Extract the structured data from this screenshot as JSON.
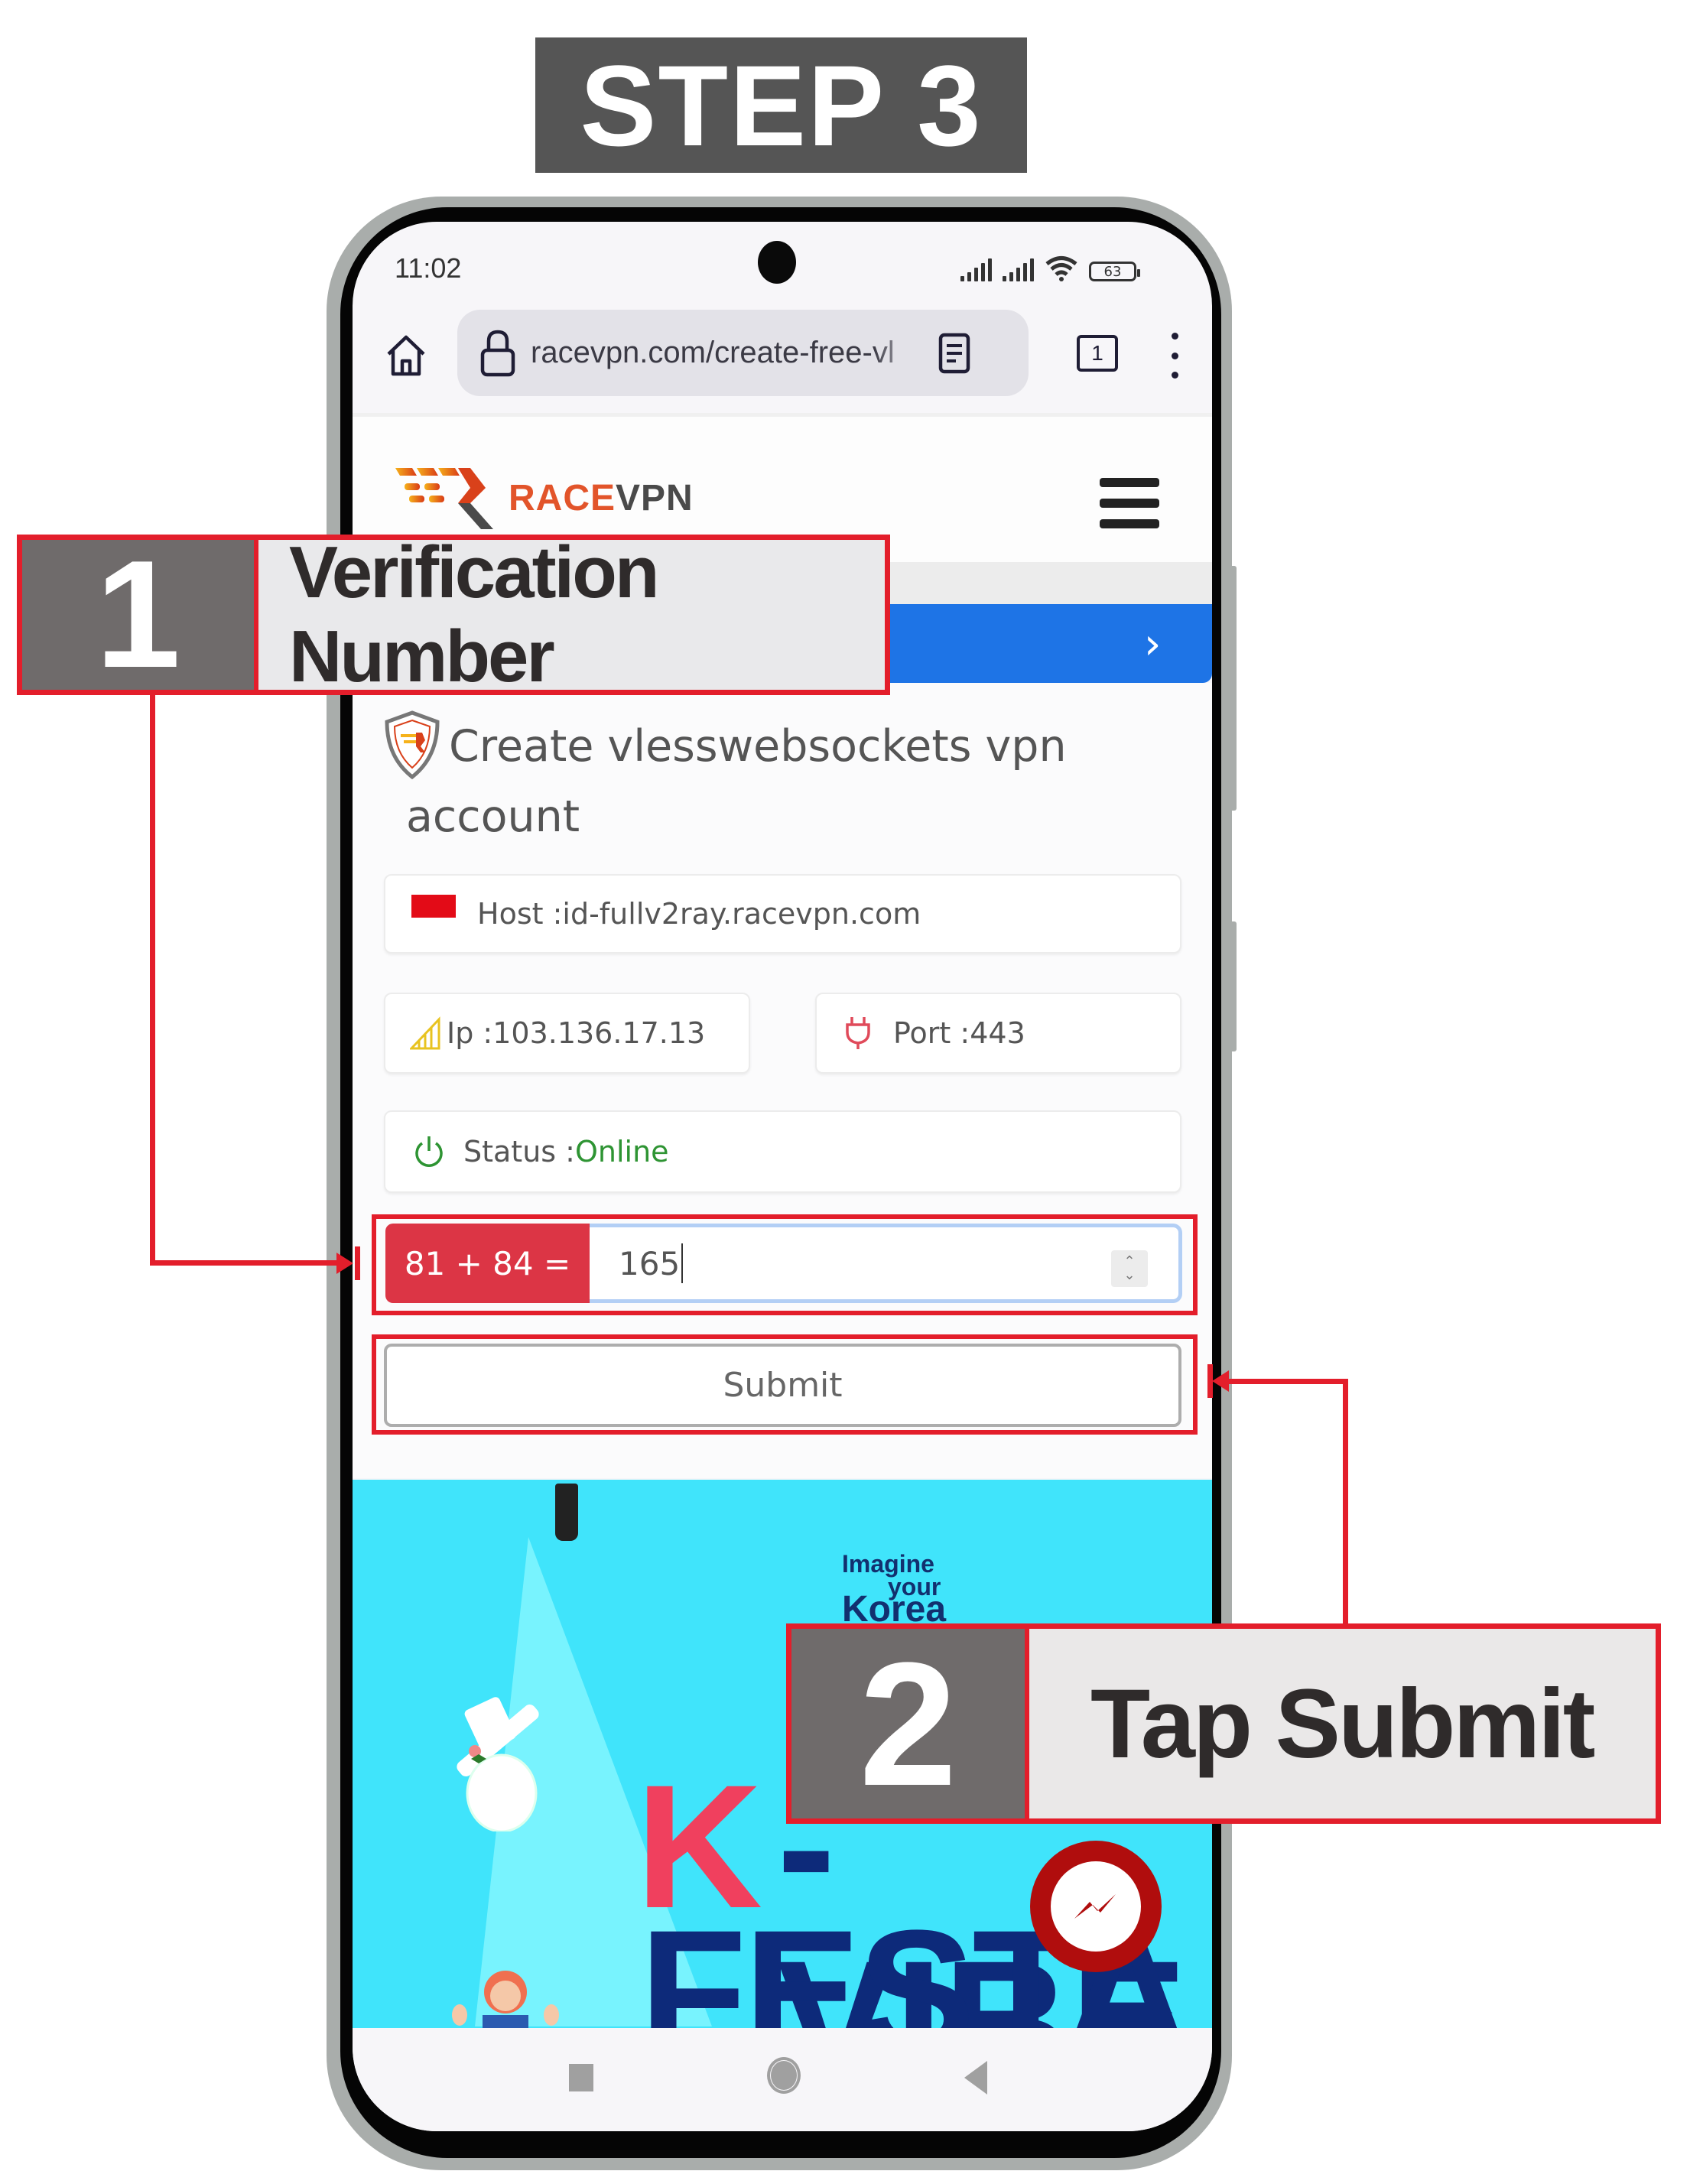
{
  "step_banner": {
    "label": "STEP 3"
  },
  "status_bar": {
    "time": "11:02",
    "battery_level": "63",
    "icons": [
      "signal-icon",
      "signal-icon",
      "wifi-icon",
      "battery-icon"
    ]
  },
  "browser": {
    "url": "racevpn.com/create-free-vless-websockets",
    "url_visible": "racevpn.com/create-free-vl",
    "tab_count": "1",
    "icons": [
      "home-icon",
      "lock-icon",
      "reader-mode-icon",
      "tabs-icon",
      "more-vert-icon"
    ]
  },
  "site": {
    "logo_race": "RACE",
    "logo_vpn": "VPN",
    "menu_icon": "hamburger-icon",
    "banner_chevron": "›"
  },
  "form": {
    "title": "Create vlesswebsockets vpn account",
    "host_label": "Host : ",
    "host_value": "id-fullv2ray.racevpn.com",
    "ip_label": "Ip : ",
    "ip_value": "103.136.17.13",
    "port_label": "Port : ",
    "port_value": "443",
    "status_label": "Status : ",
    "status_value": "Online",
    "captcha_question": "81 + 84 =",
    "captcha_answer": "165",
    "submit_label": "Submit",
    "colors": {
      "captcha_label_bg": "#dc3545",
      "status_online": "#2e9433",
      "banner_blue": "#1e74e6"
    }
  },
  "ad": {
    "tagline_1": "Imagine",
    "tagline_2": "your",
    "tagline_3": "Korea",
    "headline_k": "K",
    "headline_vibe": "-VIBE",
    "headline_festa": "FESTA"
  },
  "nav_bar": {
    "icons": [
      "recent-apps-icon",
      "home-circle-icon",
      "back-icon"
    ]
  },
  "annotations": {
    "callout_1": {
      "number": "1",
      "text": "Verification Number"
    },
    "callout_2": {
      "number": "2",
      "text": "Tap Submit"
    },
    "accent": "#e31e2b"
  }
}
